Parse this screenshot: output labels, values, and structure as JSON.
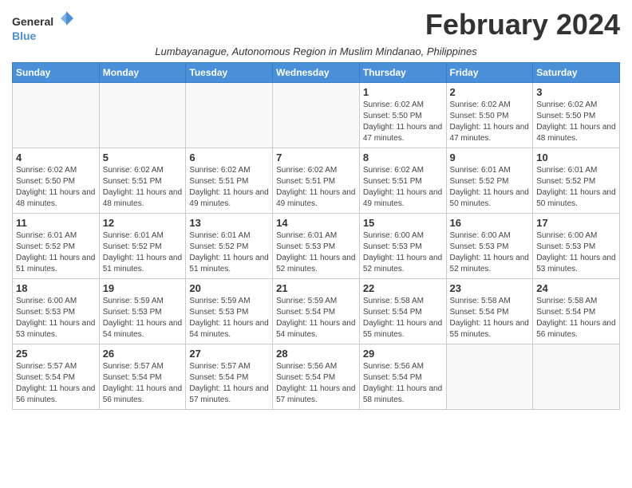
{
  "header": {
    "logo_line1": "General",
    "logo_line2": "Blue",
    "month_title": "February 2024",
    "subtitle": "Lumbayanague, Autonomous Region in Muslim Mindanao, Philippines"
  },
  "days_of_week": [
    "Sunday",
    "Monday",
    "Tuesday",
    "Wednesday",
    "Thursday",
    "Friday",
    "Saturday"
  ],
  "weeks": [
    [
      {
        "day": "",
        "sunrise": "",
        "sunset": "",
        "daylight": ""
      },
      {
        "day": "",
        "sunrise": "",
        "sunset": "",
        "daylight": ""
      },
      {
        "day": "",
        "sunrise": "",
        "sunset": "",
        "daylight": ""
      },
      {
        "day": "",
        "sunrise": "",
        "sunset": "",
        "daylight": ""
      },
      {
        "day": "1",
        "sunrise": "Sunrise: 6:02 AM",
        "sunset": "Sunset: 5:50 PM",
        "daylight": "Daylight: 11 hours and 47 minutes."
      },
      {
        "day": "2",
        "sunrise": "Sunrise: 6:02 AM",
        "sunset": "Sunset: 5:50 PM",
        "daylight": "Daylight: 11 hours and 47 minutes."
      },
      {
        "day": "3",
        "sunrise": "Sunrise: 6:02 AM",
        "sunset": "Sunset: 5:50 PM",
        "daylight": "Daylight: 11 hours and 48 minutes."
      }
    ],
    [
      {
        "day": "4",
        "sunrise": "Sunrise: 6:02 AM",
        "sunset": "Sunset: 5:50 PM",
        "daylight": "Daylight: 11 hours and 48 minutes."
      },
      {
        "day": "5",
        "sunrise": "Sunrise: 6:02 AM",
        "sunset": "Sunset: 5:51 PM",
        "daylight": "Daylight: 11 hours and 48 minutes."
      },
      {
        "day": "6",
        "sunrise": "Sunrise: 6:02 AM",
        "sunset": "Sunset: 5:51 PM",
        "daylight": "Daylight: 11 hours and 49 minutes."
      },
      {
        "day": "7",
        "sunrise": "Sunrise: 6:02 AM",
        "sunset": "Sunset: 5:51 PM",
        "daylight": "Daylight: 11 hours and 49 minutes."
      },
      {
        "day": "8",
        "sunrise": "Sunrise: 6:02 AM",
        "sunset": "Sunset: 5:51 PM",
        "daylight": "Daylight: 11 hours and 49 minutes."
      },
      {
        "day": "9",
        "sunrise": "Sunrise: 6:01 AM",
        "sunset": "Sunset: 5:52 PM",
        "daylight": "Daylight: 11 hours and 50 minutes."
      },
      {
        "day": "10",
        "sunrise": "Sunrise: 6:01 AM",
        "sunset": "Sunset: 5:52 PM",
        "daylight": "Daylight: 11 hours and 50 minutes."
      }
    ],
    [
      {
        "day": "11",
        "sunrise": "Sunrise: 6:01 AM",
        "sunset": "Sunset: 5:52 PM",
        "daylight": "Daylight: 11 hours and 51 minutes."
      },
      {
        "day": "12",
        "sunrise": "Sunrise: 6:01 AM",
        "sunset": "Sunset: 5:52 PM",
        "daylight": "Daylight: 11 hours and 51 minutes."
      },
      {
        "day": "13",
        "sunrise": "Sunrise: 6:01 AM",
        "sunset": "Sunset: 5:52 PM",
        "daylight": "Daylight: 11 hours and 51 minutes."
      },
      {
        "day": "14",
        "sunrise": "Sunrise: 6:01 AM",
        "sunset": "Sunset: 5:53 PM",
        "daylight": "Daylight: 11 hours and 52 minutes."
      },
      {
        "day": "15",
        "sunrise": "Sunrise: 6:00 AM",
        "sunset": "Sunset: 5:53 PM",
        "daylight": "Daylight: 11 hours and 52 minutes."
      },
      {
        "day": "16",
        "sunrise": "Sunrise: 6:00 AM",
        "sunset": "Sunset: 5:53 PM",
        "daylight": "Daylight: 11 hours and 52 minutes."
      },
      {
        "day": "17",
        "sunrise": "Sunrise: 6:00 AM",
        "sunset": "Sunset: 5:53 PM",
        "daylight": "Daylight: 11 hours and 53 minutes."
      }
    ],
    [
      {
        "day": "18",
        "sunrise": "Sunrise: 6:00 AM",
        "sunset": "Sunset: 5:53 PM",
        "daylight": "Daylight: 11 hours and 53 minutes."
      },
      {
        "day": "19",
        "sunrise": "Sunrise: 5:59 AM",
        "sunset": "Sunset: 5:53 PM",
        "daylight": "Daylight: 11 hours and 54 minutes."
      },
      {
        "day": "20",
        "sunrise": "Sunrise: 5:59 AM",
        "sunset": "Sunset: 5:53 PM",
        "daylight": "Daylight: 11 hours and 54 minutes."
      },
      {
        "day": "21",
        "sunrise": "Sunrise: 5:59 AM",
        "sunset": "Sunset: 5:54 PM",
        "daylight": "Daylight: 11 hours and 54 minutes."
      },
      {
        "day": "22",
        "sunrise": "Sunrise: 5:58 AM",
        "sunset": "Sunset: 5:54 PM",
        "daylight": "Daylight: 11 hours and 55 minutes."
      },
      {
        "day": "23",
        "sunrise": "Sunrise: 5:58 AM",
        "sunset": "Sunset: 5:54 PM",
        "daylight": "Daylight: 11 hours and 55 minutes."
      },
      {
        "day": "24",
        "sunrise": "Sunrise: 5:58 AM",
        "sunset": "Sunset: 5:54 PM",
        "daylight": "Daylight: 11 hours and 56 minutes."
      }
    ],
    [
      {
        "day": "25",
        "sunrise": "Sunrise: 5:57 AM",
        "sunset": "Sunset: 5:54 PM",
        "daylight": "Daylight: 11 hours and 56 minutes."
      },
      {
        "day": "26",
        "sunrise": "Sunrise: 5:57 AM",
        "sunset": "Sunset: 5:54 PM",
        "daylight": "Daylight: 11 hours and 56 minutes."
      },
      {
        "day": "27",
        "sunrise": "Sunrise: 5:57 AM",
        "sunset": "Sunset: 5:54 PM",
        "daylight": "Daylight: 11 hours and 57 minutes."
      },
      {
        "day": "28",
        "sunrise": "Sunrise: 5:56 AM",
        "sunset": "Sunset: 5:54 PM",
        "daylight": "Daylight: 11 hours and 57 minutes."
      },
      {
        "day": "29",
        "sunrise": "Sunrise: 5:56 AM",
        "sunset": "Sunset: 5:54 PM",
        "daylight": "Daylight: 11 hours and 58 minutes."
      },
      {
        "day": "",
        "sunrise": "",
        "sunset": "",
        "daylight": ""
      },
      {
        "day": "",
        "sunrise": "",
        "sunset": "",
        "daylight": ""
      }
    ]
  ]
}
